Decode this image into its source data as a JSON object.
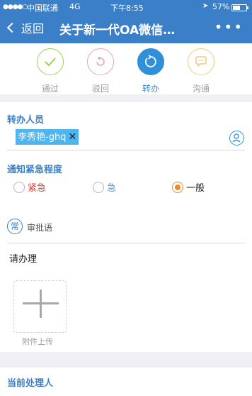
{
  "status_bar": {
    "signal": "●●●●○",
    "carrier": "中国联通",
    "network": "4G",
    "time": "下午8:55",
    "battery_pct": "57%",
    "battery_level": 0.57
  },
  "nav": {
    "back_label": "返回",
    "title": "关于新一代OA微信…",
    "more_label": "•••"
  },
  "actions": [
    {
      "label": "通过",
      "icon": "check-icon",
      "color": "#9bd05f"
    },
    {
      "label": "驳回",
      "icon": "reject-icon",
      "color": "#e8a3bd"
    },
    {
      "label": "转办",
      "icon": "transfer-icon",
      "color": "#2f8fd8",
      "active": true
    },
    {
      "label": "沟通",
      "icon": "chat-icon",
      "color": "#f3c97d"
    }
  ],
  "transfer": {
    "title": "转办人员",
    "chip_name": "李秀艳-ghq",
    "chip_remove": "✕"
  },
  "urgency": {
    "title": "通知紧急程度",
    "options": [
      {
        "label": "紧急",
        "color": "#e3423d",
        "selected": false
      },
      {
        "label": "急",
        "color": "#45a7e6",
        "selected": false
      },
      {
        "label": "一般",
        "color": "#222222",
        "selected": true
      }
    ]
  },
  "approval": {
    "common_badge": "常",
    "label": "审批语",
    "comment": "请办理",
    "upload_label": "附件上传"
  },
  "handler": {
    "title": "当前处理人"
  },
  "colors": {
    "header": "#3b7fc8",
    "accent": "#2f8fd8",
    "selected_radio": "#f08a2a"
  }
}
